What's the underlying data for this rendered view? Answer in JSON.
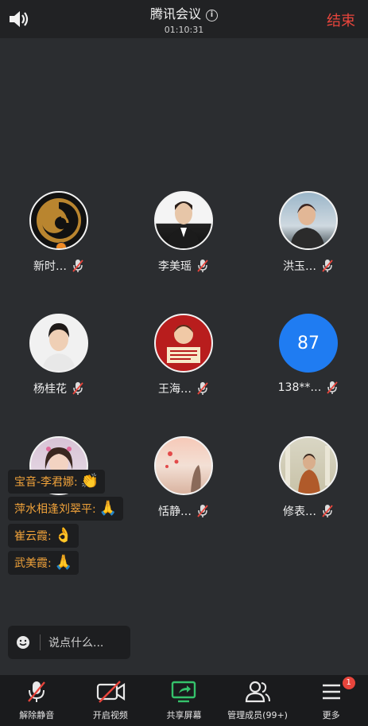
{
  "header": {
    "title": "腾讯会议",
    "timer": "01:10:31",
    "end_label": "结束"
  },
  "participants": [
    {
      "name": "新时…",
      "avatar": "logo-avatar",
      "host": true
    },
    {
      "name": "李美瑶",
      "avatar": "photo-avatar"
    },
    {
      "name": "洪玉…",
      "avatar": "photo-avatar"
    },
    {
      "name": "杨桂花",
      "avatar": "photo-avatar"
    },
    {
      "name": "王海…",
      "avatar": "poster-avatar"
    },
    {
      "name": "138**…",
      "avatar": "initial-avatar",
      "initial": "87"
    },
    {
      "name": "",
      "avatar": "photo-avatar"
    },
    {
      "name": "恬静…",
      "avatar": "photo-avatar"
    },
    {
      "name": "修表…",
      "avatar": "photo-avatar"
    }
  ],
  "chat": {
    "messages": [
      {
        "text": "宝音-李君娜:",
        "emoji": "👏"
      },
      {
        "text": "萍水相逢刘翠平:",
        "emoji": "🙏"
      },
      {
        "text": "崔云霞:",
        "emoji": "👌"
      },
      {
        "text": "武美霞:",
        "emoji": "🙏"
      }
    ],
    "input_placeholder": "说点什么..."
  },
  "toolbar": {
    "unmute_label": "解除静音",
    "video_label": "开启视频",
    "share_label": "共享屏幕",
    "members_label": "管理成员(99+)",
    "more_label": "更多",
    "more_badge": "1"
  },
  "colors": {
    "background": "#2b2d30",
    "end": "#e8453c",
    "chat_name": "#f0a23a",
    "share_green": "#35c26b",
    "initial_blue": "#1f7cf2"
  }
}
